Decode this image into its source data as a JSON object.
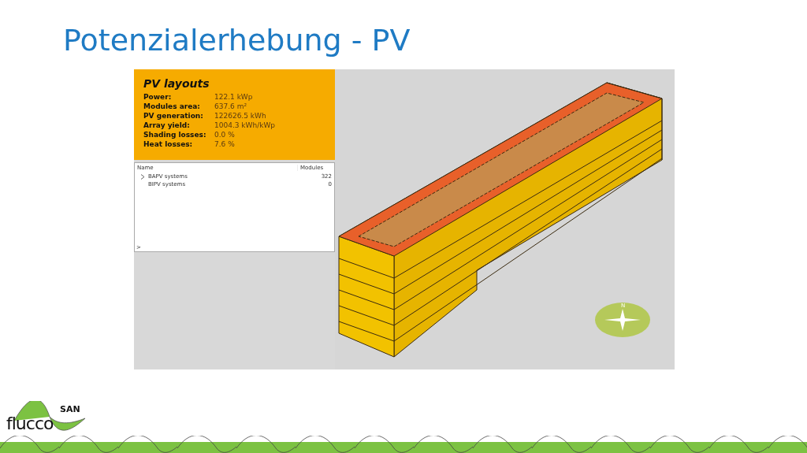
{
  "slide": {
    "title": "Potenzialerhebung - PV"
  },
  "app": {
    "summary": {
      "title": "PV layouts",
      "rows": [
        {
          "label": "Power:",
          "value": "122.1 kWp"
        },
        {
          "label": "Modules area:",
          "value": "637.6 m²"
        },
        {
          "label": "PV generation:",
          "value": "122626.5 kWh"
        },
        {
          "label": "Array yield:",
          "value": "1004.3 kWh/kWp"
        },
        {
          "label": "Shading losses:",
          "value": "0.0 %"
        },
        {
          "label": "Heat losses:",
          "value": "7.6 %"
        }
      ]
    },
    "tree": {
      "columns": [
        "Name",
        "Modules"
      ],
      "rows": [
        {
          "name": "BAPV systems",
          "modules": "322",
          "expandable": true
        },
        {
          "name": "BIPV systems",
          "modules": "0",
          "expandable": false
        }
      ],
      "prompt": ">"
    },
    "compass": {
      "label": "N"
    }
  },
  "logo": {
    "name": "flucco",
    "suffix": "SAN"
  }
}
